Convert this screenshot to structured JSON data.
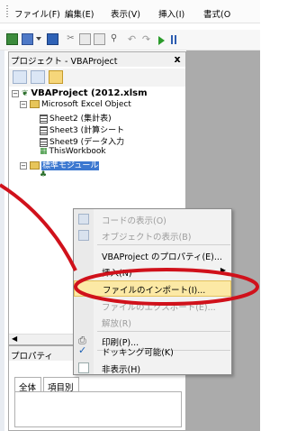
{
  "menubar": {
    "items": [
      "ファイル(F)",
      "編集(E)",
      "表示(V)",
      "挿入(I)",
      "書式(O"
    ]
  },
  "project_pane": {
    "title": "プロジェクト - VBAProject",
    "close_label": "x"
  },
  "tree": {
    "root": "VBAProject (2012.xlsm",
    "folder_objects": "Microsoft Excel Object",
    "sheet2": "Sheet2 (集計表)",
    "sheet3": "Sheet3 (計算シート",
    "sheet9": "Sheet9 (データ入力",
    "workbook": "ThisWorkbook",
    "folder_modules": "標準モジュール"
  },
  "context_menu": {
    "items": [
      {
        "label": "コードの表示(O)",
        "disabled": true
      },
      {
        "label": "オブジェクトの表示(B)",
        "disabled": true
      },
      {
        "label": "VBAProject のプロパティ(E)...",
        "disabled": false
      },
      {
        "label": "挿入(N)",
        "disabled": false
      },
      {
        "label": "ファイルのインポート(I)...",
        "disabled": false
      },
      {
        "label": "ファイルのエクスポート(E)...",
        "disabled": true
      },
      {
        "label": "解放(R)",
        "disabled": true
      },
      {
        "label": "印刷(P)...",
        "disabled": false
      },
      {
        "label": "ドッキング可能(K)",
        "disabled": false
      },
      {
        "label": "非表示(H)",
        "disabled": false
      }
    ]
  },
  "properties_pane": {
    "title": "プロパティ",
    "tab_all": "全体",
    "tab_category": "項目別"
  },
  "colors": {
    "highlight": "#3c78d0",
    "annotation": "#d0111b",
    "hover": "#fce9a5"
  }
}
